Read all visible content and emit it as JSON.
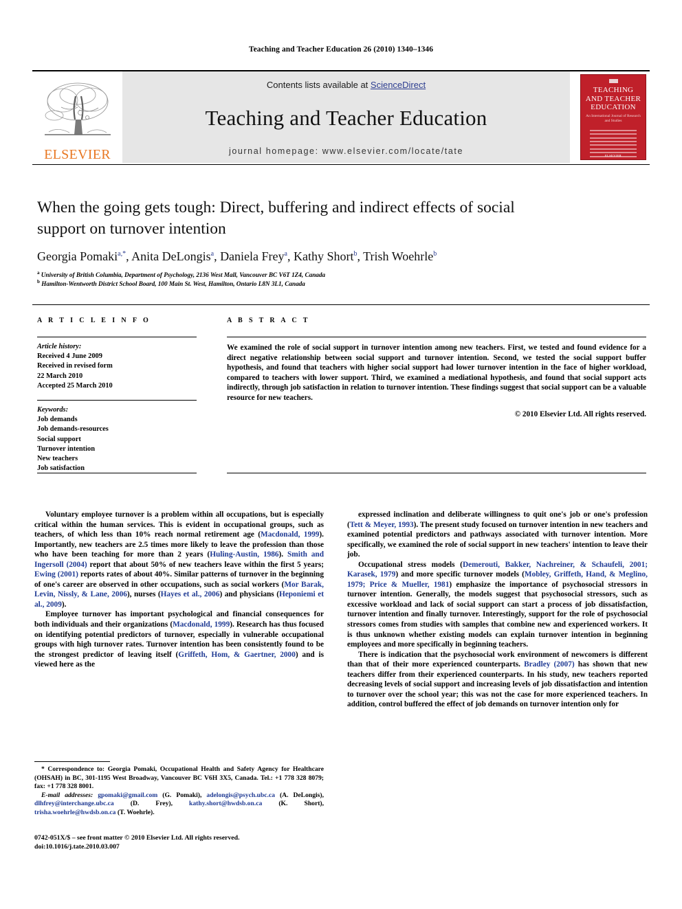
{
  "running_head": "Teaching and Teacher Education 26 (2010) 1340–1346",
  "masthead": {
    "contents_prefix": "Contents lists available at ",
    "sciencedirect": "ScienceDirect",
    "journal_name": "Teaching and Teacher Education",
    "homepage": "journal homepage: www.elsevier.com/locate/tate",
    "publisher_wordmark": "ELSEVIER",
    "accent_orange": "#E87722",
    "link_blue": "#2b3c8f",
    "cover": {
      "line1": "TEACHING",
      "line2": "AND TEACHER",
      "line3": "EDUCATION",
      "subtitle": "An International Journal of Research and Studies",
      "footer": "ELSEVIER",
      "color": "#c0202a"
    }
  },
  "title": "When the going gets tough: Direct, buffering and indirect effects of social support on turnover intention",
  "authors_html": "Georgia Pomaki<sup>a,*</sup>, Anita DeLongis<sup>a</sup>, Daniela Frey<sup>a</sup>, Kathy Short<sup>b</sup>, Trish Woehrle<sup>b</sup>",
  "affiliations": [
    "University of British Columbia, Department of Psychology, 2136 West Mall, Vancouver BC V6T 1Z4, Canada",
    "Hamilton-Wentworth District School Board, 100 Main St. West, Hamilton, Ontario L8N 3L1, Canada"
  ],
  "section_headings": {
    "article_info": "A R T I C L E  I N F O",
    "abstract": "A B S T R A C T"
  },
  "article_history": {
    "label": "Article history:",
    "lines": [
      "Received 4 June 2009",
      "Received in revised form",
      "22 March 2010",
      "Accepted 25 March 2010"
    ]
  },
  "keywords": {
    "label": "Keywords:",
    "items": [
      "Job demands",
      "Job demands-resources",
      "Social support",
      "Turnover intention",
      "New teachers",
      "Job satisfaction"
    ]
  },
  "abstract": {
    "text": "We examined the role of social support in turnover intention among new teachers. First, we tested and found evidence for a direct negative relationship between social support and turnover intention. Second, we tested the social support buffer hypothesis, and found that teachers with higher social support had lower turnover intention in the face of higher workload, compared to teachers with lower support. Third, we examined a mediational hypothesis, and found that social support acts indirectly, through job satisfaction in relation to turnover intention. These findings suggest that social support can be a valuable resource for new teachers.",
    "copyright": "© 2010 Elsevier Ltd. All rights reserved."
  },
  "body": {
    "left_paragraphs_html": [
      "Voluntary employee turnover is a problem within all occupations, but is especially critical within the human services. This is evident in occupational groups, such as teachers, of which less than 10% reach normal retirement age (<span class=\"cit\">Macdonald, 1999</span>). Importantly, new teachers are 2.5 times more likely to leave the profession than those who have been teaching for more than 2 years (<span class=\"cit\">Huling-Austin, 1986</span>). <span class=\"cit\">Smith and Ingersoll (2004)</span> report that about 50% of new teachers leave within the first 5 years; <span class=\"cit\">Ewing (2001)</span> reports rates of about 40%. Similar patterns of turnover in the beginning of one's career are observed in other occupations, such as social workers (<span class=\"cit\">Mor Barak, Levin, Nissly, &amp; Lane, 2006</span>), nurses (<span class=\"cit\">Hayes et al., 2006</span>) and physicians (<span class=\"cit\">Heponiemi et al., 2009</span>).",
      "Employee turnover has important psychological and financial consequences for both individuals and their organizations (<span class=\"cit\">Macdonald, 1999</span>). Research has thus focused on identifying potential predictors of turnover, especially in vulnerable occupational groups with high turnover rates. Turnover intention has been consistently found to be the strongest predictor of leaving itself (<span class=\"cit\">Griffeth, Hom, &amp; Gaertner, 2000</span>) and is viewed here as the"
    ],
    "right_paragraphs_html": [
      "expressed inclination and deliberate willingness to quit one's job or one's profession (<span class=\"cit\">Tett &amp; Meyer, 1993</span>). The present study focused on turnover intention in new teachers and examined potential predictors and pathways associated with turnover intention. More specifically, we examined the role of social support in new teachers' intention to leave their job.",
      "Occupational stress models (<span class=\"cit\">Demerouti, Bakker, Nachreiner, &amp; Schaufeli, 2001; Karasek, 1979</span>) and more specific turnover models (<span class=\"cit\">Mobley, Griffeth, Hand, &amp; Meglino, 1979; Price &amp; Mueller, 1981</span>) emphasize the importance of psychosocial stressors in turnover intention. Generally, the models suggest that psychosocial stressors, such as excessive workload and lack of social support can start a process of job dissatisfaction, turnover intention and finally turnover. Interestingly, support for the role of psychosocial stressors comes from studies with samples that combine new and experienced workers. It is thus unknown whether existing models can explain turnover intention in beginning employees and more specifically in beginning teachers.",
      "There is indication that the psychosocial work environment of newcomers is different than that of their more experienced counterparts. <span class=\"cit\">Bradley (2007)</span> has shown that new teachers differ from their experienced counterparts. In his study, new teachers reported decreasing levels of social support and increasing levels of job dissatisfaction and intention to turnover over the school year; this was not the case for more experienced teachers. In addition, control buffered the effect of job demands on turnover intention only for"
    ]
  },
  "footnote": {
    "correspondence_html": "* Correspondence to: Georgia Pomaki, Occupational Health and Safety Agency for Healthcare (OHSAH) in BC, 301-1195 West Broadway, Vancouver BC V6H 3X5, Canada. Tel.: +1 778 328 8079; fax: +1 778 328 8001.",
    "emails_html": "<span class=\"em\">E-mail addresses:</span> <span class=\"mail\">gpomaki@gmail.com</span> (G. Pomaki), <span class=\"mail\">adelongis@psych.ubc.ca</span> (A. DeLongis), <span class=\"mail\">dlhfrey@interchange.ubc.ca</span> (D. Frey), <span class=\"mail\">kathy.short@hwdsb.on.ca</span> (K. Short), <span class=\"mail\">trisha.woehrle@hwdsb.on.ca</span> (T. Woehrle)."
  },
  "imprint": {
    "line1": "0742-051X/$ – see front matter © 2010 Elsevier Ltd. All rights reserved.",
    "line2": "doi:10.1016/j.tate.2010.03.007"
  }
}
